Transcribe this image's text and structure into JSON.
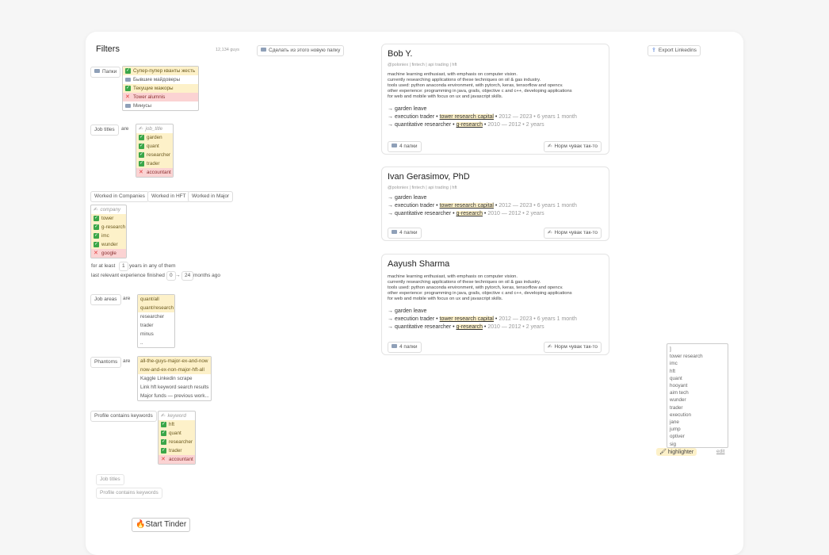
{
  "header": {
    "title": "Filters",
    "count": "12,134 guys",
    "new_folder": "Сделать из этого новую папку",
    "export": "Export Linkedins"
  },
  "folders": {
    "button": "Папки",
    "items": [
      {
        "label": "Супер-пупер кванты жесть",
        "state": "yes"
      },
      {
        "label": "Бывшие майдоверы",
        "state": "folder"
      },
      {
        "label": "Текущие мажоры",
        "state": "yes"
      },
      {
        "label": "Tower alumnis",
        "state": "no"
      },
      {
        "label": "Минусы",
        "state": "folder"
      }
    ]
  },
  "job_titles": {
    "label": "Job titles",
    "op": "are",
    "placeholder": "job_title",
    "items": [
      {
        "label": "garden",
        "state": "yes"
      },
      {
        "label": "quant",
        "state": "yes"
      },
      {
        "label": "researcher",
        "state": "yes"
      },
      {
        "label": "trader",
        "state": "yes"
      },
      {
        "label": "accountant",
        "state": "no"
      }
    ]
  },
  "worked": {
    "buttons": [
      "Worked in Companies",
      "Worked in HFT",
      "Worked in Major"
    ],
    "placeholder": "company",
    "items": [
      {
        "label": "tower",
        "state": "yes"
      },
      {
        "label": "g-research",
        "state": "yes"
      },
      {
        "label": "imc",
        "state": "yes"
      },
      {
        "label": "wunder",
        "state": "yes"
      },
      {
        "label": "google",
        "state": "no"
      }
    ],
    "atleast_pre": "for at least",
    "atleast_val": "1",
    "atleast_post": "years in any of them",
    "last_pre": "last relevant experience finished",
    "last_from": "0",
    "last_arrow": "→",
    "last_to": "24",
    "last_post": "months ago"
  },
  "job_areas": {
    "label": "Job areas",
    "op": "are",
    "items": [
      {
        "label": "quant/all",
        "state": "hl"
      },
      {
        "label": "quant/research",
        "state": "hl"
      },
      {
        "label": "researcher",
        "state": "plain"
      },
      {
        "label": "trader",
        "state": "plain"
      },
      {
        "label": "minus",
        "state": "plain"
      },
      {
        "label": "..",
        "state": "plain"
      }
    ]
  },
  "phantoms": {
    "label": "Phantoms",
    "op": "are",
    "items": [
      {
        "label": "all-the-guys-major-ex-and-now",
        "state": "hl"
      },
      {
        "label": "now-and-ex-non-major-hft-all",
        "state": "hl"
      },
      {
        "label": "Kaggle Linkedin scrape",
        "state": "plain"
      },
      {
        "label": "Link hft keyword search results",
        "state": "plain"
      },
      {
        "label": "Major funds — previous work...",
        "state": "plain"
      }
    ]
  },
  "keywords": {
    "label": "Profile contains keywords",
    "placeholder": "keyword",
    "items": [
      {
        "label": "hft",
        "state": "yes"
      },
      {
        "label": "quant",
        "state": "yes"
      },
      {
        "label": "researcher",
        "state": "yes"
      },
      {
        "label": "trader",
        "state": "yes"
      },
      {
        "label": "accountant",
        "state": "no"
      }
    ]
  },
  "extra_filters": [
    "Job titles",
    "Profile contains keywords"
  ],
  "start": {
    "icon": "🔥",
    "label": "Start Tinder"
  },
  "profiles": [
    {
      "name": "Bob Y.",
      "tags": "@poloniex | fintech | api trading | hft",
      "desc": [
        "machine learning enthusiast, with emphasis on computer vision.",
        "currently researching applications of these techniques on oil & gas industry.",
        "tools used: python anaconda environment, with pytorch, keras, tensorflow and opencv.",
        "other experience: programming in java, grails, objective c and c++, developing applications",
        "for web and mobile with focus on ux and javascript skills."
      ],
      "exp": [
        {
          "arrow": "→",
          "title": "garden leave",
          "company": "",
          "dates": ""
        },
        {
          "arrow": "→",
          "title": "execution trader",
          "company": "tower research capital",
          "dates": "2012 — 2023 • 6 years 1 month"
        },
        {
          "arrow": "→",
          "title": "quantitative researcher",
          "company": "g-research",
          "dates": "2010 — 2012 • 2 years"
        }
      ],
      "folders": "4 папки",
      "note": "Норм чувак так-то"
    },
    {
      "name": "Ivan Gerasimov, PhD",
      "tags": "@poloniex | fintech | api trading | hft",
      "desc": [],
      "exp": [
        {
          "arrow": "→",
          "title": "garden leave",
          "company": "",
          "dates": ""
        },
        {
          "arrow": "→",
          "title": "execution trader",
          "company": "tower research capital",
          "dates": "2012 — 2023 • 6 years 1 month"
        },
        {
          "arrow": "→",
          "title": "quantitative researcher",
          "company": "g-research",
          "dates": "2010 — 2012 • 2 years"
        }
      ],
      "folders": "4 папки",
      "note": "Норм чувак так-то"
    },
    {
      "name": "Aayush Sharma",
      "tags": "",
      "desc": [
        "machine learning enthusiast, with emphasis on computer vision.",
        "currently researching applications of these techniques on oil & gas industry.",
        "tools used: python anaconda environment, with pytorch, keras, tensorflow and opencv.",
        "other experience: programming in java, grails, objective c and c++, developing applications",
        "for web and mobile with focus on ux and javascript skills."
      ],
      "exp": [
        {
          "arrow": "→",
          "title": "garden leave",
          "company": "",
          "dates": ""
        },
        {
          "arrow": "→",
          "title": "execution trader",
          "company": "tower research capital",
          "dates": "2012 — 2023 • 6 years 1 month"
        },
        {
          "arrow": "→",
          "title": "quantitative researcher",
          "company": "g-research",
          "dates": "2010 — 2012 • 2 years"
        }
      ],
      "folders": "4 папки",
      "note": "Норм чувак так-то"
    }
  ],
  "highlighter": {
    "words": [
      "]",
      "tower research",
      "imc",
      "hft",
      "quant",
      "hooyant",
      "aim tech",
      "wunder",
      "trader",
      "execution",
      "jane",
      "jump",
      "optiver",
      "sig"
    ],
    "label": "highlighter",
    "edit": "edit"
  }
}
